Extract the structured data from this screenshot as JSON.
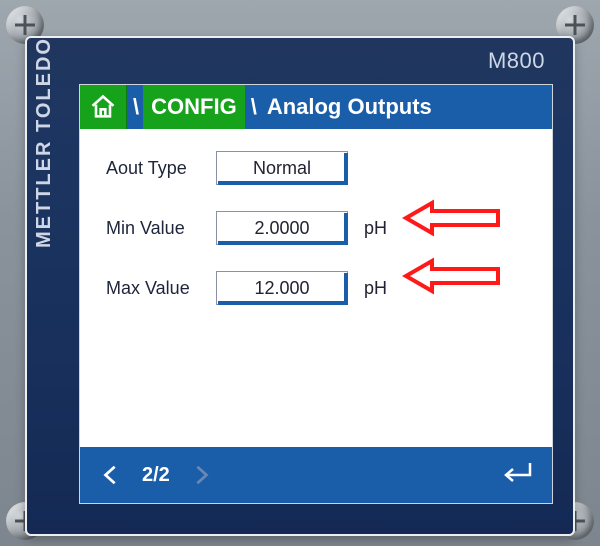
{
  "device": {
    "brand": "METTLER TOLEDO",
    "model": "M800"
  },
  "breadcrumb": {
    "config_label": "CONFIG",
    "tail": "Analog  Outputs",
    "sep": "\\"
  },
  "fields": {
    "aout_type": {
      "label": "Aout Type",
      "value": "Normal"
    },
    "min_value": {
      "label": "Min Value",
      "value": "2.0000",
      "unit": "pH"
    },
    "max_value": {
      "label": "Max Value",
      "value": "12.000",
      "unit": "pH"
    }
  },
  "nav": {
    "page": "2/2"
  }
}
